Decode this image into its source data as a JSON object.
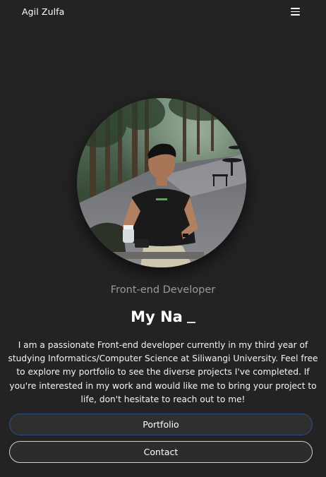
{
  "navbar": {
    "brand": "Agil Zulfa",
    "menu_icon": "hamburger-menu-icon"
  },
  "hero": {
    "photo_alt": "Agil Zulfa portrait",
    "role": "Front-end Developer",
    "typed_name": "My Na",
    "bio": "I am a passionate Front-end developer currently in my third year of studying Informatics/Computer Science at Siliwangi University. Feel free to explore my portfolio to see the diverse projects I've completed. If you're interested in my work and would like me to bring your project to life, don't hesitate to reach out to me!"
  },
  "actions": {
    "portfolio_label": "Portfolio",
    "contact_label": "Contact"
  },
  "colors": {
    "background": "#232323",
    "portfolio_border": "#2b4d86",
    "contact_border": "#cfcfcf"
  }
}
